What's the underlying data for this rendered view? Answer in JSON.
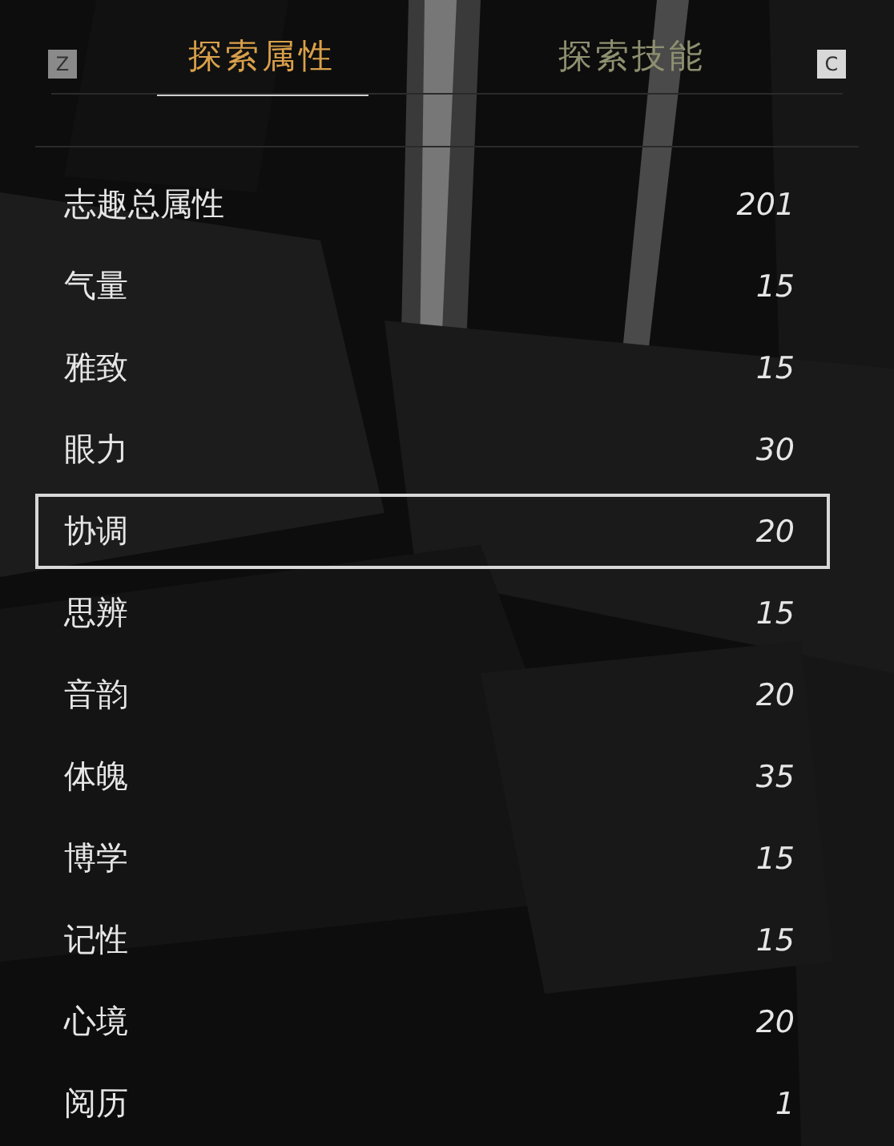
{
  "key_hints": {
    "left": "Z",
    "right": "C"
  },
  "tabs": [
    {
      "label": "探索属性",
      "selected": true
    },
    {
      "label": "探索技能",
      "selected": false
    }
  ],
  "attributes": [
    {
      "name": "志趣总属性",
      "value": "201",
      "selected": false
    },
    {
      "name": "气量",
      "value": "15",
      "selected": false
    },
    {
      "name": "雅致",
      "value": "15",
      "selected": false
    },
    {
      "name": "眼力",
      "value": "30",
      "selected": false
    },
    {
      "name": "协调",
      "value": "20",
      "selected": true
    },
    {
      "name": "思辨",
      "value": "15",
      "selected": false
    },
    {
      "name": "音韵",
      "value": "20",
      "selected": false
    },
    {
      "name": "体魄",
      "value": "35",
      "selected": false
    },
    {
      "name": "博学",
      "value": "15",
      "selected": false
    },
    {
      "name": "记性",
      "value": "15",
      "selected": false
    },
    {
      "name": "心境",
      "value": "20",
      "selected": false
    },
    {
      "name": "阅历",
      "value": "1",
      "selected": false
    }
  ]
}
